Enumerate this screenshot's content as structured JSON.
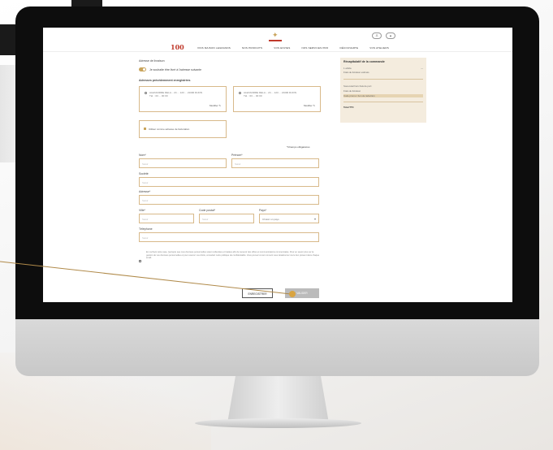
{
  "screen": {
    "header": {
      "logo_text": "100",
      "menu_items": [
        "VINS MAISON LEGRANDS",
        "NOS PRODUITS",
        "VOS ENVIES",
        "NOS SERVICES PRO",
        "DÉCOUVERTE",
        "VOS ATELIERS"
      ],
      "icon_left": "person-icon",
      "icon_right": "cart-icon"
    },
    "form": {
      "section_address_title": "Adresse de livraison",
      "toggle_label": "Je souhaite être livré à l'adresse suivante",
      "saved_addresses_title": "Adresses précédemment enregistrées",
      "address_cards": [
        {
          "text": "ALEXANDRE DELA... 24 ... 123 ... 21000 DIJON",
          "sub": "Tél. : 03 ... 00 00",
          "edit": "Modifier"
        },
        {
          "text": "ALEXANDRE DELA... 24 ... 123 ... 21000 DIJON",
          "sub": "Tél. : 03 ... 00 00",
          "edit": "Modifier"
        }
      ],
      "billing_label": "Utiliser comme adresse de facturation",
      "required_note": "*Champs obligatoires",
      "fields": {
        "nom_label": "Nom*",
        "nom_placeholder": "Saisir",
        "prenom_label": "Prénom*",
        "prenom_placeholder": "Saisir",
        "societe_label": "Société",
        "societe_placeholder": "Saisir",
        "adresse_label": "Adresse*",
        "adresse_placeholder": "Saisir",
        "ville_label": "Ville*",
        "ville_placeholder": "Saisir",
        "cp_label": "Code postal*",
        "cp_placeholder": "Saisir",
        "pays_label": "Pays*",
        "pays_value": "Choisir un pays",
        "tel_label": "Téléphone",
        "tel_placeholder": "Saisir"
      },
      "legal_text": "En cochant cette case, j'accepte que mes données personnelles soient collectées et traitées afin de recevoir des offres et communications commerciales. Pour en savoir plus sur la gestion de vos données personnelles et pour exercer vos droits, consultez notre politique de confidentialité. Vous pouvez à tout moment vous désabonner via le lien présent dans chaque email.",
      "btn_secondary": "ENREGISTRER",
      "btn_primary": "VALIDER"
    },
    "summary": {
      "title": "Récapitulatif de la commande",
      "row_a_label": "1 article",
      "row_a_value": "—",
      "row_b_label": "Frais de livraison estimés",
      "row_b_value": "",
      "row_c_label": "Sous-total hors frais de port",
      "row_c_value": "",
      "row_d_label": "Frais de livraison",
      "row_d_value": "",
      "row_e_label": "Code promo / bon de réduction",
      "row_e_value": "",
      "row_total_label": "Total TTC",
      "row_total_value": ""
    }
  },
  "colors": {
    "accent_gold": "#c9a45c",
    "brand_red": "#c0392b",
    "summary_bg": "#f4ecde"
  }
}
